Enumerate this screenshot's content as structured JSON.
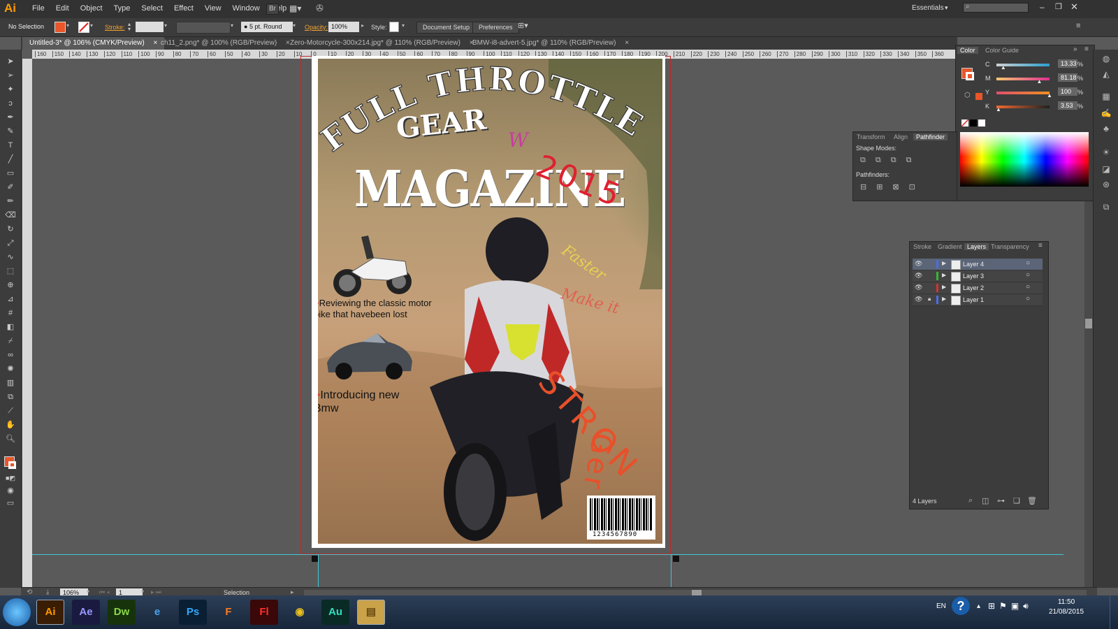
{
  "app": {
    "logo": "Ai"
  },
  "menu": {
    "items": [
      "File",
      "Edit",
      "Object",
      "Type",
      "Select",
      "Effect",
      "View",
      "Window",
      "Help"
    ],
    "bridge": "Br"
  },
  "workspace": {
    "label": "Essentials",
    "search_placeholder": ""
  },
  "control": {
    "selection": "No Selection",
    "stroke_label": "Stroke:",
    "brush": "5 pt. Round",
    "opacity_label": "Opacity:",
    "opacity": "100%",
    "style_label": "Style:",
    "document_setup": "Document Setup",
    "preferences": "Preferences"
  },
  "tabs": [
    {
      "label": "Untitled-3* @ 106% (CMYK/Preview)",
      "active": true
    },
    {
      "label": "ch11_2.png* @ 100% (RGB/Preview)"
    },
    {
      "label": "Zero-Motorcycle-300x214.jpg* @ 110% (RGB/Preview)"
    },
    {
      "label": "BMW-i8-advert-5.jpg* @ 110% (RGB/Preview)"
    }
  ],
  "ruler": {
    "ticks": [
      "160",
      "150",
      "140",
      "130",
      "120",
      "110",
      "100",
      "90",
      "80",
      "70",
      "60",
      "50",
      "40",
      "30",
      "20",
      "10",
      "0",
      "10",
      "20",
      "30",
      "40",
      "50",
      "60",
      "70",
      "80",
      "90",
      "100",
      "110",
      "120",
      "130",
      "140",
      "150",
      "160",
      "170",
      "180",
      "190",
      "200",
      "210",
      "220",
      "230",
      "240",
      "250",
      "260",
      "270",
      "280",
      "290",
      "300",
      "310",
      "320",
      "330",
      "340",
      "350",
      "360"
    ]
  },
  "cover": {
    "title_line1": "FULL THROTTLE",
    "title_line2": "GEAR",
    "mark_w": "W",
    "magazine": "MAGAZINE",
    "year": "2015",
    "faster": "Faster",
    "make_it": "Make it",
    "stronger_1": "STRON",
    "stronger_2": "Ger",
    "story1_arrow": ">",
    "story1": "Reviewing the classic motor bike that havebeen lost",
    "story2_arrow": ">",
    "story2": "Introducing new Bmw",
    "barcode": "1234567890"
  },
  "color_panel": {
    "tabs": [
      "Color",
      "Color Guide"
    ],
    "channels": [
      {
        "name": "C",
        "value": "13.33",
        "pos": 0.13,
        "grad": "linear-gradient(90deg,#d0d0d0,#2aa0d0)"
      },
      {
        "name": "M",
        "value": "81.18",
        "pos": 0.81,
        "grad": "linear-gradient(90deg,#f4c870,#e03090)"
      },
      {
        "name": "Y",
        "value": "100",
        "pos": 1.0,
        "grad": "linear-gradient(90deg,#e05070,#f09020)"
      },
      {
        "name": "K",
        "value": "3.53",
        "pos": 0.04,
        "grad": "linear-gradient(90deg,#f06a30,#202020)"
      }
    ],
    "unit": "%"
  },
  "pathfinder_panel": {
    "tabs": [
      "Transform",
      "Align",
      "Pathfinder"
    ],
    "shape_modes": "Shape Modes:",
    "pathfinders": "Pathfinders:"
  },
  "layers_panel": {
    "tabs": [
      "Stroke",
      "Gradient",
      "Layers",
      "Transparency"
    ],
    "layers": [
      {
        "name": "Layer 4",
        "color": "#4b6ee0",
        "selected": true,
        "locked": false
      },
      {
        "name": "Layer 3",
        "color": "#35b830",
        "selected": false,
        "locked": false
      },
      {
        "name": "Layer 2",
        "color": "#d83232",
        "selected": false,
        "locked": false
      },
      {
        "name": "Layer 1",
        "color": "#4a6ee8",
        "selected": false,
        "locked": true
      }
    ],
    "count": "4 Layers"
  },
  "status": {
    "zoom": "106%",
    "artboard": "1",
    "tool": "Selection"
  },
  "taskbar": {
    "apps": [
      {
        "name": "Ai",
        "bg": "#3a1d05",
        "fg": "#ff9a00"
      },
      {
        "name": "Ae",
        "bg": "#1a1a40",
        "fg": "#9999ff"
      },
      {
        "name": "Dw",
        "bg": "#17330c",
        "fg": "#8ad64a"
      },
      {
        "name": "e",
        "bg": "transparent",
        "fg": "#49a6f0"
      },
      {
        "name": "Ps",
        "bg": "#0a1f33",
        "fg": "#31a8ff"
      },
      {
        "name": "F",
        "bg": "transparent",
        "fg": "#ff7a20"
      },
      {
        "name": "Fl",
        "bg": "#3a0808",
        "fg": "#ff3030"
      },
      {
        "name": "◉",
        "bg": "transparent",
        "fg": "#e8c020"
      },
      {
        "name": "Au",
        "bg": "#0a2a26",
        "fg": "#2fe0c0"
      },
      {
        "name": "▤",
        "bg": "#c9a24a",
        "fg": "#6a4a10"
      }
    ],
    "lang": "EN",
    "time": "11:50",
    "date": "21/08/2015"
  },
  "colors": {
    "fill": "#e8562a",
    "accent": "#ff9a00"
  }
}
